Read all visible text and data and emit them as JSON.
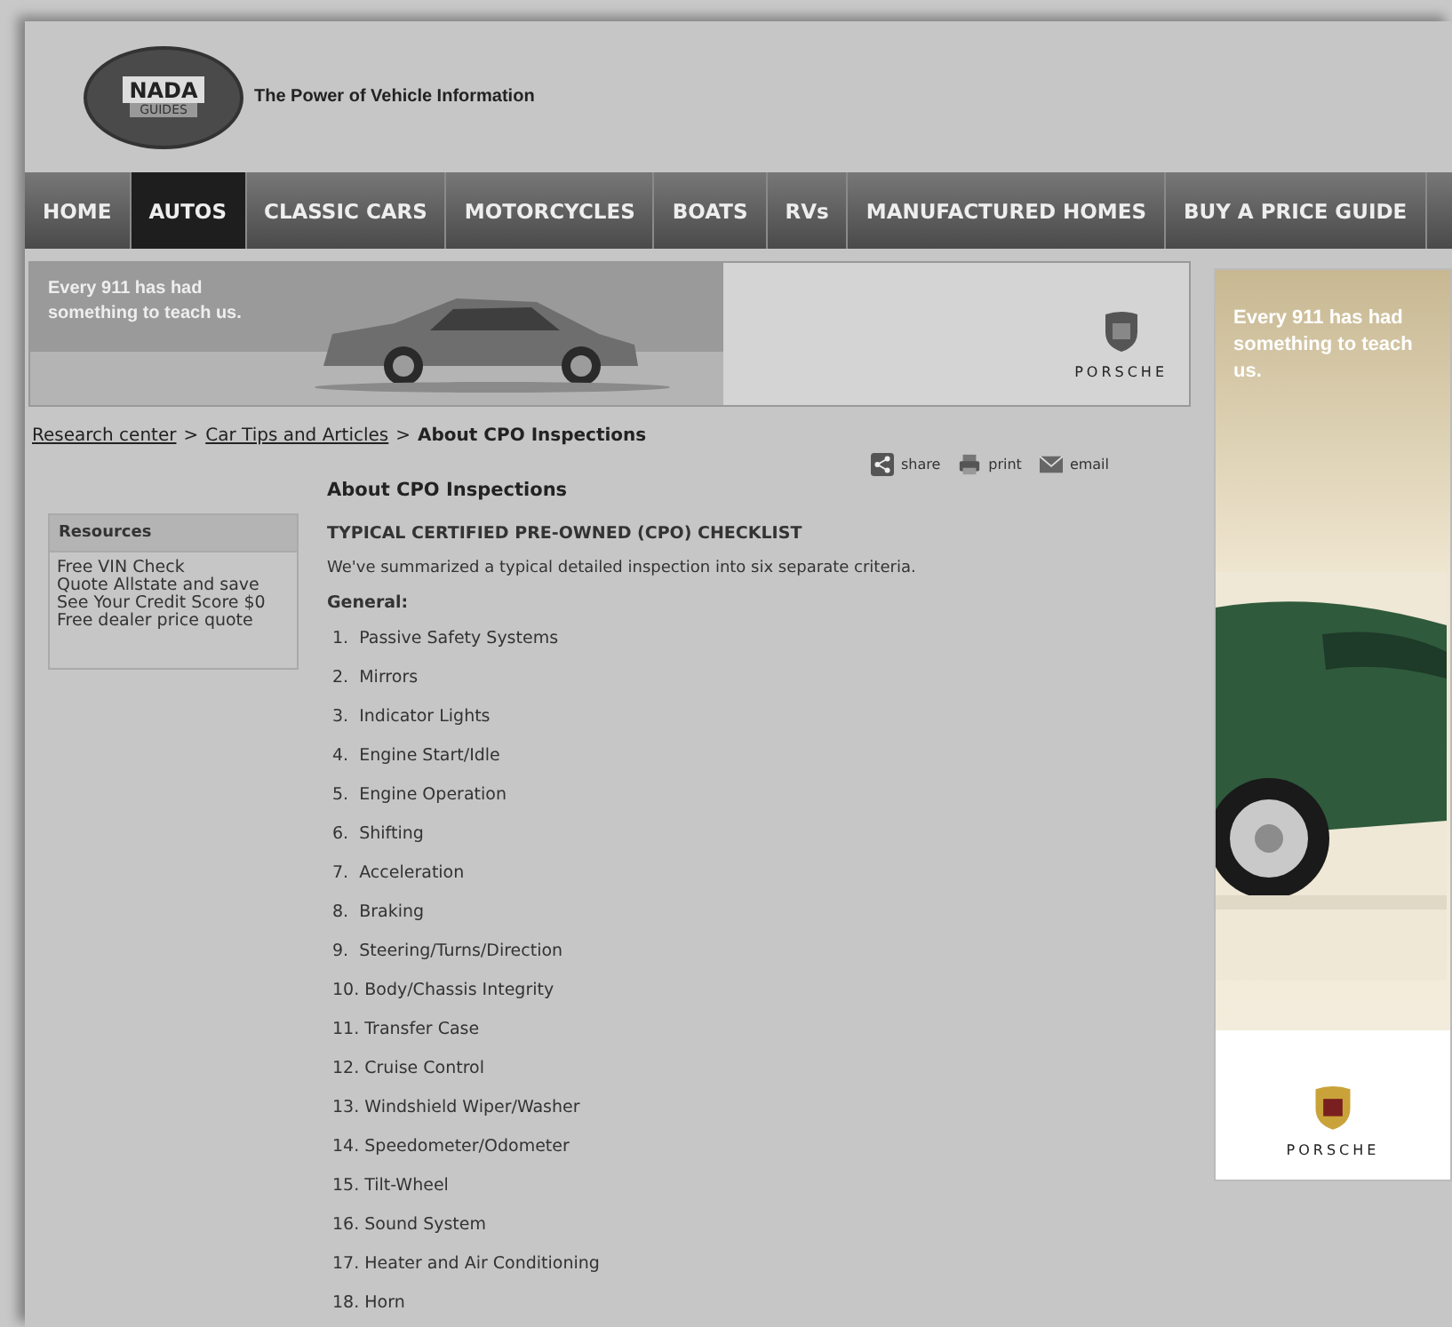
{
  "header": {
    "logo_top": "NADA",
    "logo_bottom": "GUIDES",
    "tagline": "The Power of Vehicle Information"
  },
  "nav": [
    {
      "label": "HOME",
      "selected": false
    },
    {
      "label": "AUTOS",
      "selected": true
    },
    {
      "label": "CLASSIC CARS",
      "selected": false
    },
    {
      "label": "MOTORCYCLES",
      "selected": false
    },
    {
      "label": "BOATS",
      "selected": false
    },
    {
      "label": "RVs",
      "selected": false
    },
    {
      "label": "MANUFACTURED HOMES",
      "selected": false
    },
    {
      "label": "BUY A PRICE GUIDE",
      "selected": false
    }
  ],
  "banner_ad": {
    "headline": "Every 911 has had something to teach us.",
    "brand": "PORSCHE"
  },
  "breadcrumb": {
    "links": [
      "Research center",
      "Car Tips and Articles"
    ],
    "separator": ">",
    "current": "About CPO Inspections"
  },
  "resources": {
    "title": "Resources",
    "links": [
      "Free VIN Check",
      "Quote Allstate and save",
      "See Your Credit Score $0",
      "Free dealer price quote"
    ]
  },
  "actions": [
    "share",
    "print",
    "email"
  ],
  "article": {
    "title": "About CPO Inspections",
    "subtitle": "TYPICAL CERTIFIED PRE-OWNED (CPO) CHECKLIST",
    "intro": "We've summarized a typical detailed inspection into six separate criteria.",
    "section": "General:",
    "items": [
      "1.  Passive Safety Systems",
      "2.  Mirrors",
      "3.  Indicator Lights",
      "4.  Engine Start/Idle",
      "5.  Engine Operation",
      "6.  Shifting",
      "7.  Acceleration",
      "8.  Braking",
      "9.  Steering/Turns/Direction",
      "10. Body/Chassis Integrity",
      "11. Transfer Case",
      "12. Cruise Control",
      "13. Windshield Wiper/Washer",
      "14. Speedometer/Odometer",
      "15. Tilt-Wheel",
      "16. Sound System",
      "17. Heater and Air Conditioning",
      "18. Horn"
    ]
  },
  "side_ad": {
    "headline": "Every 911 has had something to teach us.",
    "brand": "PORSCHE"
  }
}
